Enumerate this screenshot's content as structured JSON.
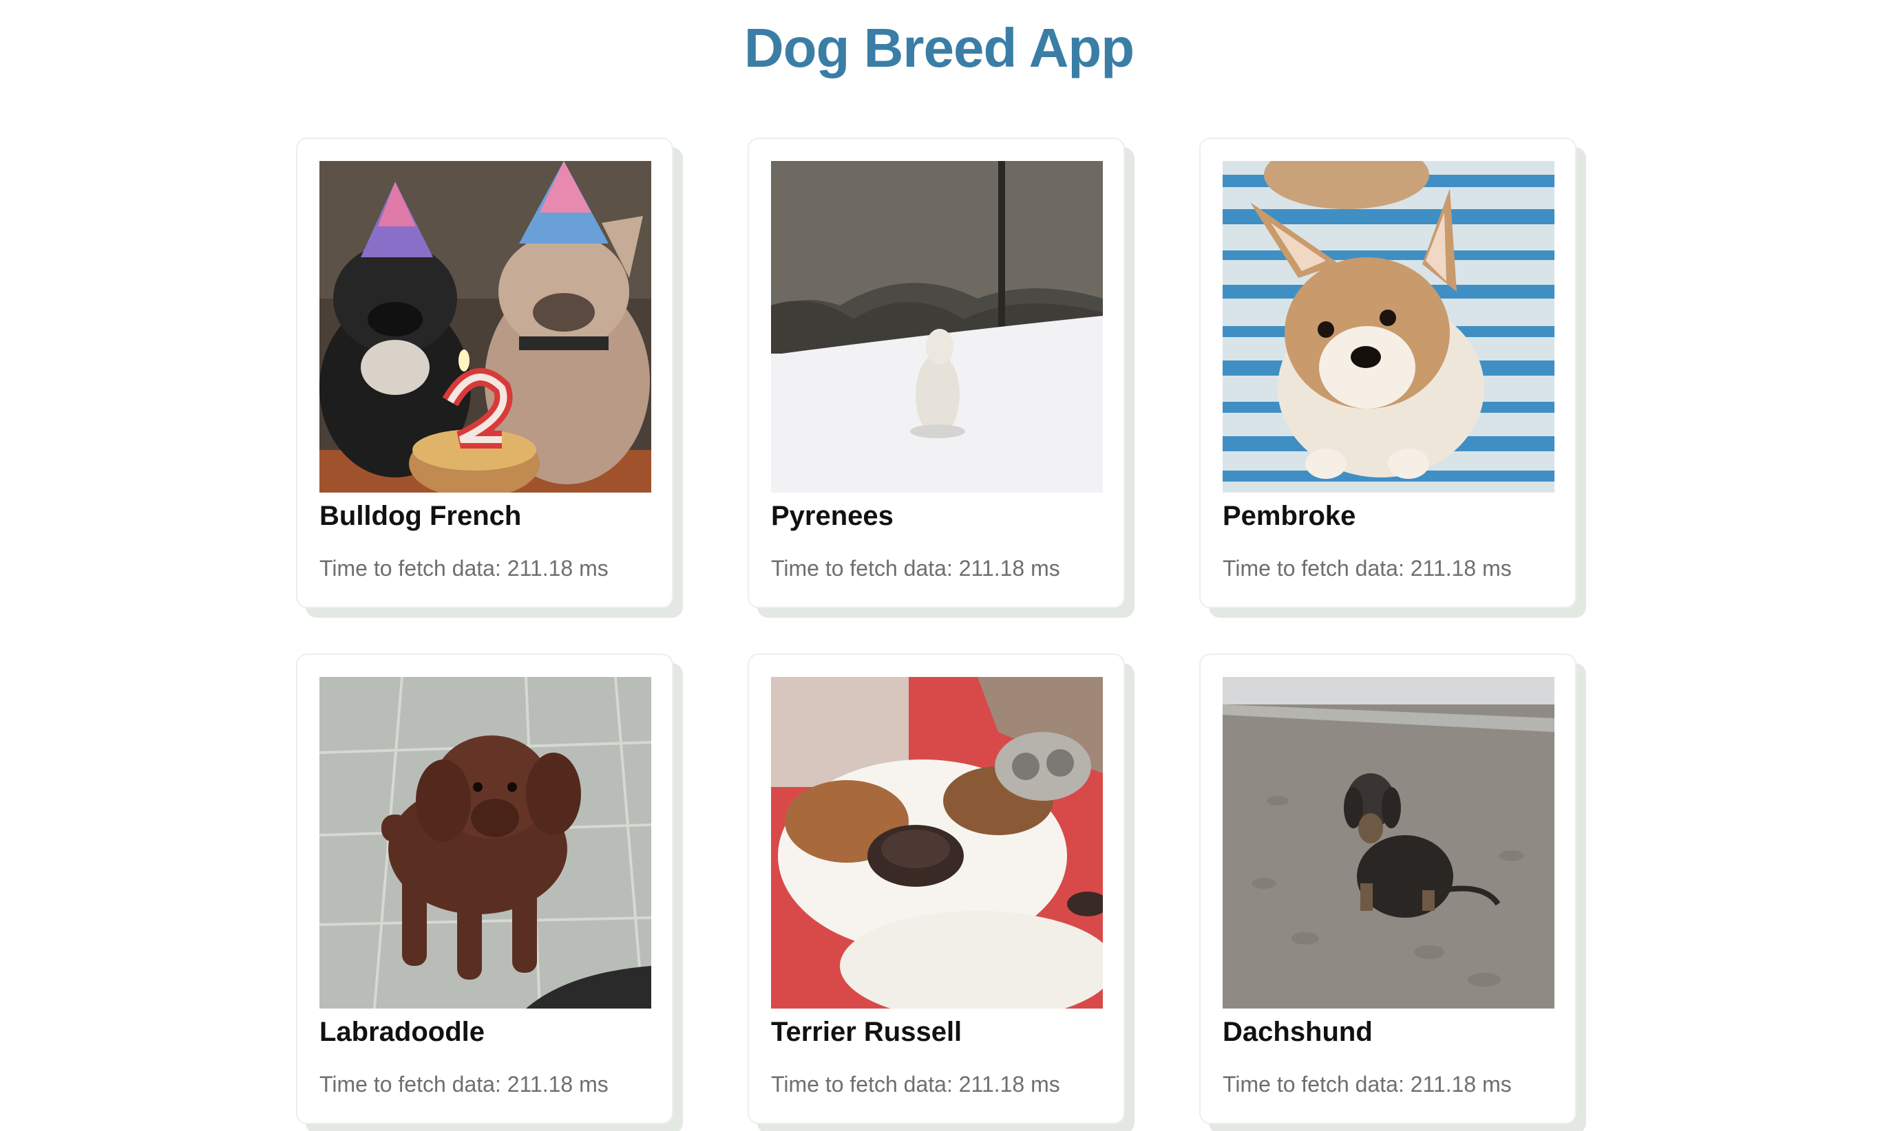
{
  "app": {
    "title": "Dog Breed App"
  },
  "colors": {
    "title": "#3a7ea6",
    "card_border": "#eeeeee",
    "card_shadow": "#e3e8e3",
    "breed_name": "#111111",
    "fetch_time": "#6e6e6e"
  },
  "breeds": [
    {
      "name": "Bulldog French",
      "fetch_time": "Time to fetch data: 211.18 ms",
      "image": "french-bulldogs-birthday-photo"
    },
    {
      "name": "Pyrenees",
      "fetch_time": "Time to fetch data: 211.18 ms",
      "image": "pyrenees-in-snow-photo"
    },
    {
      "name": "Pembroke",
      "fetch_time": "Time to fetch data: 211.18 ms",
      "image": "corgi-puppy-on-rug-photo"
    },
    {
      "name": "Labradoodle",
      "fetch_time": "Time to fetch data: 211.18 ms",
      "image": "labradoodle-on-patio-photo"
    },
    {
      "name": "Terrier Russell",
      "fetch_time": "Time to fetch data: 211.18 ms",
      "image": "terrier-closeup-photo"
    },
    {
      "name": "Dachshund",
      "fetch_time": "Time to fetch data: 211.18 ms",
      "image": "dachshund-on-beach-photo"
    }
  ]
}
